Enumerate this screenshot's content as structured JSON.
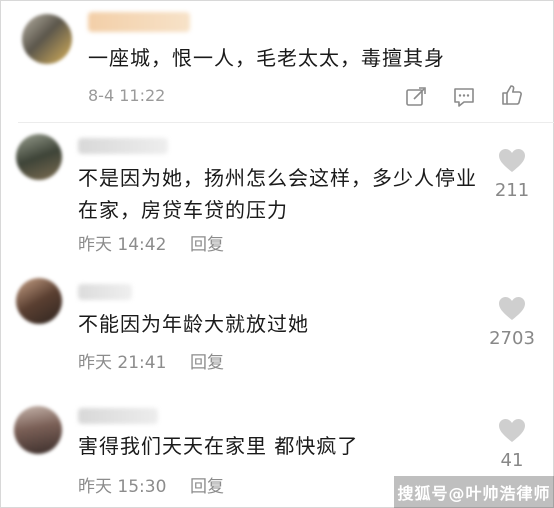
{
  "post": {
    "text": "一座城，恨一人，毛老太太，毒擅其身",
    "timestamp": "8-4 11:22",
    "actions": [
      {
        "icon": "edit-icon"
      },
      {
        "icon": "comment-icon"
      },
      {
        "icon": "thumbs-up-icon"
      }
    ]
  },
  "comments": [
    {
      "text": "不是因为她，扬州怎么会这样，多少人停业在家，房贷车贷的压力",
      "time": "昨天 14:42",
      "reply_label": "回复",
      "likes": "211"
    },
    {
      "text": "不能因为年龄大就放过她",
      "time": "昨天 21:41",
      "reply_label": "回复",
      "likes": "2703"
    },
    {
      "text": "害得我们天天在家里 都快疯了",
      "time": "昨天 15:30",
      "reply_label": "回复",
      "likes": "41"
    }
  ],
  "watermark": "搜狐号@叶帅浩律师",
  "colors": {
    "text": "#1a1a1a",
    "meta": "#8c8c8c",
    "heart": "#cfcfcf"
  }
}
